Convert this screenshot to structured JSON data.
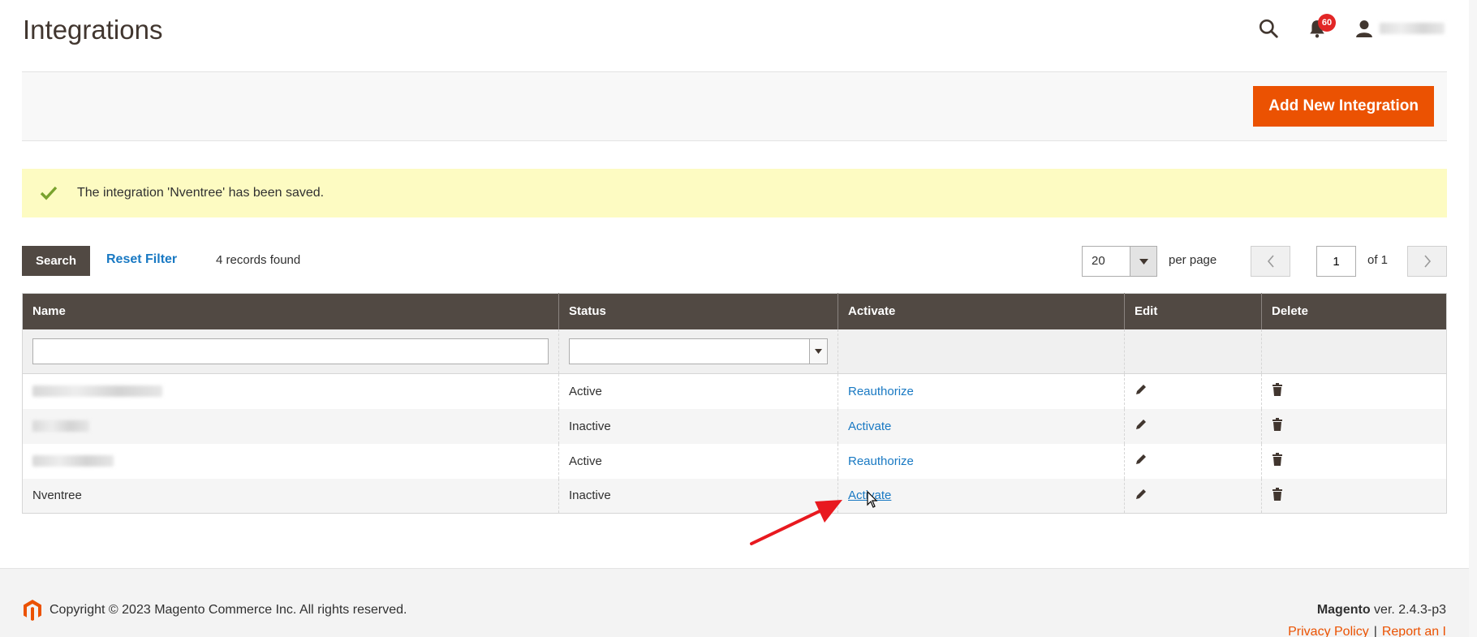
{
  "header": {
    "title": "Integrations",
    "notifications_count": "60",
    "icons": {
      "search": "search-icon",
      "notifications": "bell-icon",
      "user": "user-icon"
    }
  },
  "page_actions": {
    "add_button_label": "Add New Integration"
  },
  "message": {
    "text": "The integration 'Nventree' has been saved.",
    "icon": "check-icon"
  },
  "toolbar": {
    "search_label": "Search",
    "reset_filter_label": "Reset Filter",
    "records_found": "4 records found",
    "per_page_value": "20",
    "per_page_label": "per page",
    "page_value": "1",
    "page_of": "of 1"
  },
  "grid": {
    "columns": [
      "Name",
      "Status",
      "Activate",
      "Edit",
      "Delete"
    ],
    "rows": [
      {
        "name": "",
        "status": "Active",
        "action": "Reauthorize"
      },
      {
        "name": "",
        "status": "Inactive",
        "action": "Activate"
      },
      {
        "name": "",
        "status": "Active",
        "action": "Reauthorize"
      },
      {
        "name": "Nventree",
        "status": "Inactive",
        "action": "Activate"
      }
    ]
  },
  "footer": {
    "copyright": "Copyright © 2023 Magento Commerce Inc. All rights reserved.",
    "brand": "Magento",
    "version": "ver. 2.4.3-p3",
    "link_privacy": "Privacy Policy",
    "link_separator": "|",
    "link_report": "Report an I"
  },
  "colors": {
    "primary_button": "#eb5202",
    "grid_header": "#514943",
    "link": "#1979c3",
    "message_bg": "#fdfbc2",
    "badge": "#e22626",
    "annotation_arrow": "#e8191f"
  }
}
